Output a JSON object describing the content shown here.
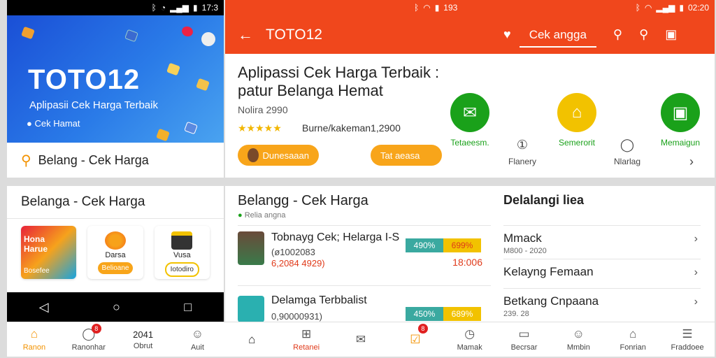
{
  "phone1": {
    "status_time": "17:3",
    "hero": {
      "logo": "TOTO12",
      "subtitle": "Aplipasii Cek Harga Terbaik",
      "tagline": "Cek Hamat"
    },
    "search_label": "Belang - Cek Harga",
    "section_title": "Belanga - Cek Harga",
    "tiles": [
      {
        "title": "Hona\nHarue",
        "label": "Bosefee"
      },
      {
        "title": "Darsa",
        "label": "Belioane"
      },
      {
        "title": "Vusa",
        "label": "Iotodiro"
      }
    ]
  },
  "phone2": {
    "status_time_left": "193",
    "status_time_right": "02:20",
    "appbar": {
      "title": "TOTO12",
      "check_label": "Cek angga"
    },
    "detail": {
      "title_line1": "Aplipassi Cek Harga Terbaik :",
      "title_line2": "patur Belanga Hemat",
      "sub": "Nolira 2990",
      "stars": "★★★★★",
      "review": "Burne/kakeman1,2900",
      "btn1": "Dunesaaan",
      "btn2": "Tat aeasa"
    },
    "features": [
      {
        "label": "Tetaeesm.",
        "icon": "✉",
        "color": "#1aa11a"
      },
      {
        "label": "Semerorit",
        "icon": "⌂",
        "color": "#f2c200"
      },
      {
        "label": "Memaigun",
        "icon": "▣",
        "color": "#1aa11a"
      }
    ],
    "minis": [
      {
        "label": "Flanery",
        "icon": "①"
      },
      {
        "label": "Nlarlag",
        "icon": "◯"
      },
      {
        "label": "",
        "icon": "›"
      }
    ],
    "list": {
      "heading": "Belangg - Cek Harga",
      "heading_sub": "Relia angna",
      "rows": [
        {
          "name": "Tobnayg Cek; Helarga I-S",
          "sub": "(ø1002083",
          "sub2": "6,2084 4929)",
          "chip1": "490%",
          "chip2": "699%",
          "price": "18:006"
        },
        {
          "name": "Delamga Terbbalist",
          "sub": "0,90000931)",
          "sub2": "",
          "chip1": "450%",
          "chip2": "689%",
          "price": ""
        }
      ]
    },
    "side": {
      "heading": "Delalangi liea",
      "rows": [
        {
          "name": "Mmack",
          "sub": "M800 - 2020"
        },
        {
          "name": "Kelayng Femaan",
          "sub": ""
        },
        {
          "name": "Betkang Cnpaana",
          "sub": "239. 28"
        }
      ]
    }
  },
  "bottom_nav": [
    {
      "label": "Ranon",
      "icon": "⌂",
      "active": true
    },
    {
      "label": "Ranonhar",
      "icon": "◯",
      "badge": "8"
    },
    {
      "label": "Obrut",
      "icon": "2041"
    },
    {
      "label": "Auit",
      "icon": "☺"
    },
    {
      "label": "",
      "icon": "⌂"
    },
    {
      "label": "Retanei",
      "icon": "⊞"
    },
    {
      "label": "",
      "icon": "✉"
    },
    {
      "label": "",
      "icon": "☑",
      "badge": "8"
    },
    {
      "label": "Mamak",
      "icon": "◷"
    },
    {
      "label": "Becrsar",
      "icon": "▭"
    },
    {
      "label": "Mmbin",
      "icon": "☺"
    },
    {
      "label": "Fonrian",
      "icon": "⌂"
    },
    {
      "label": "Fraddoee",
      "icon": "☰"
    }
  ]
}
